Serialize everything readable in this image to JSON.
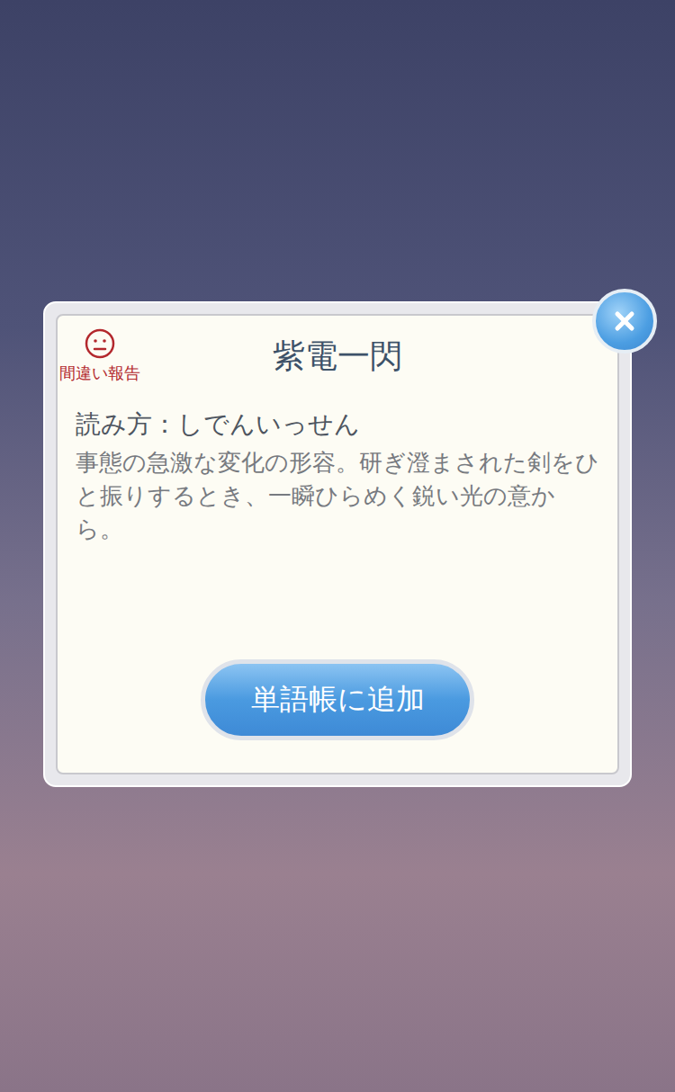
{
  "dialog": {
    "title": "紫電一閃",
    "report_label": "間違い報告",
    "reading": "読み方：しでんいっせん",
    "description": "事態の急激な変化の形容。研ぎ澄まされた剣をひと振りするとき、一瞬ひらめく鋭い光の意から。",
    "button": "単語帳に追加"
  }
}
